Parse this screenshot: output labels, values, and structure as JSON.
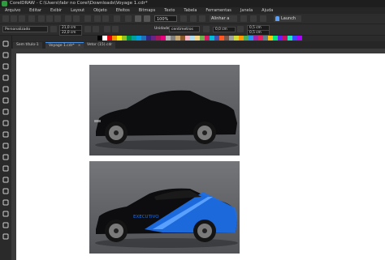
{
  "titlebar": {
    "text": "CorelDRAW - C:\\Users\\fabr no Corel\\Downloads\\Voyage 1.cdr*"
  },
  "menu": [
    "Arquivo",
    "Editar",
    "Exibir",
    "Layout",
    "Objeto",
    "Efeitos",
    "Bitmaps",
    "Texto",
    "Tabela",
    "Ferramentas",
    "Janela",
    "Ajuda"
  ],
  "toolbar": {
    "zoom": "100%",
    "snap": "Alinhar a",
    "launch": "Launch"
  },
  "propbar": {
    "preset": "Personalizado",
    "width": "21,0 cm",
    "height": "22,0 cm",
    "units_label": "Unidades:",
    "units": "centímetros",
    "nudge": "0,0 cm",
    "dup_x": "0,5 cm",
    "dup_y": "0,5 cm"
  },
  "palette": [
    "#000000",
    "#ffffff",
    "#e30613",
    "#f39200",
    "#ffed00",
    "#95c11f",
    "#009640",
    "#00a19a",
    "#009fe3",
    "#1d71b8",
    "#312783",
    "#662483",
    "#a3195b",
    "#e6007e",
    "#b2b2b2",
    "#7f7f7f",
    "#c6a875",
    "#8b5a2b",
    "#f7b6c2",
    "#aeddf2",
    "#f5d48b",
    "#6ab04c",
    "#d81b60",
    "#00bcd4",
    "#3f51b5",
    "#ff5722",
    "#795548",
    "#9e9e9e",
    "#cddc39",
    "#ff9800",
    "#4caf50",
    "#2196f3",
    "#9c27b0",
    "#e91e63",
    "#607d8b",
    "#ffc107",
    "#00e676",
    "#651fff",
    "#c51162",
    "#1de9b6",
    "#304ffe",
    "#aa00ff"
  ],
  "tabs": [
    {
      "label": "Sem título-1",
      "active": false
    },
    {
      "label": "Voyage 1.cdr*",
      "active": true
    },
    {
      "label": "Vetor (15).cdr",
      "active": false
    }
  ],
  "photos": {
    "badge_text": "EXECUTIVO"
  },
  "colors": {
    "accent": "#1e6fe8",
    "car_body": "#0d0d0f"
  },
  "tools": [
    "pick-icon",
    "shape-icon",
    "crop-icon",
    "zoom-icon",
    "freehand-icon",
    "artistic-media-icon",
    "rectangle-icon",
    "ellipse-icon",
    "polygon-icon",
    "text-icon",
    "parallel-dimension-icon",
    "connector-icon",
    "shadow-icon",
    "transparency-icon",
    "eyedropper-icon",
    "interactive-fill-icon",
    "smart-fill-icon",
    "outline-icon"
  ]
}
